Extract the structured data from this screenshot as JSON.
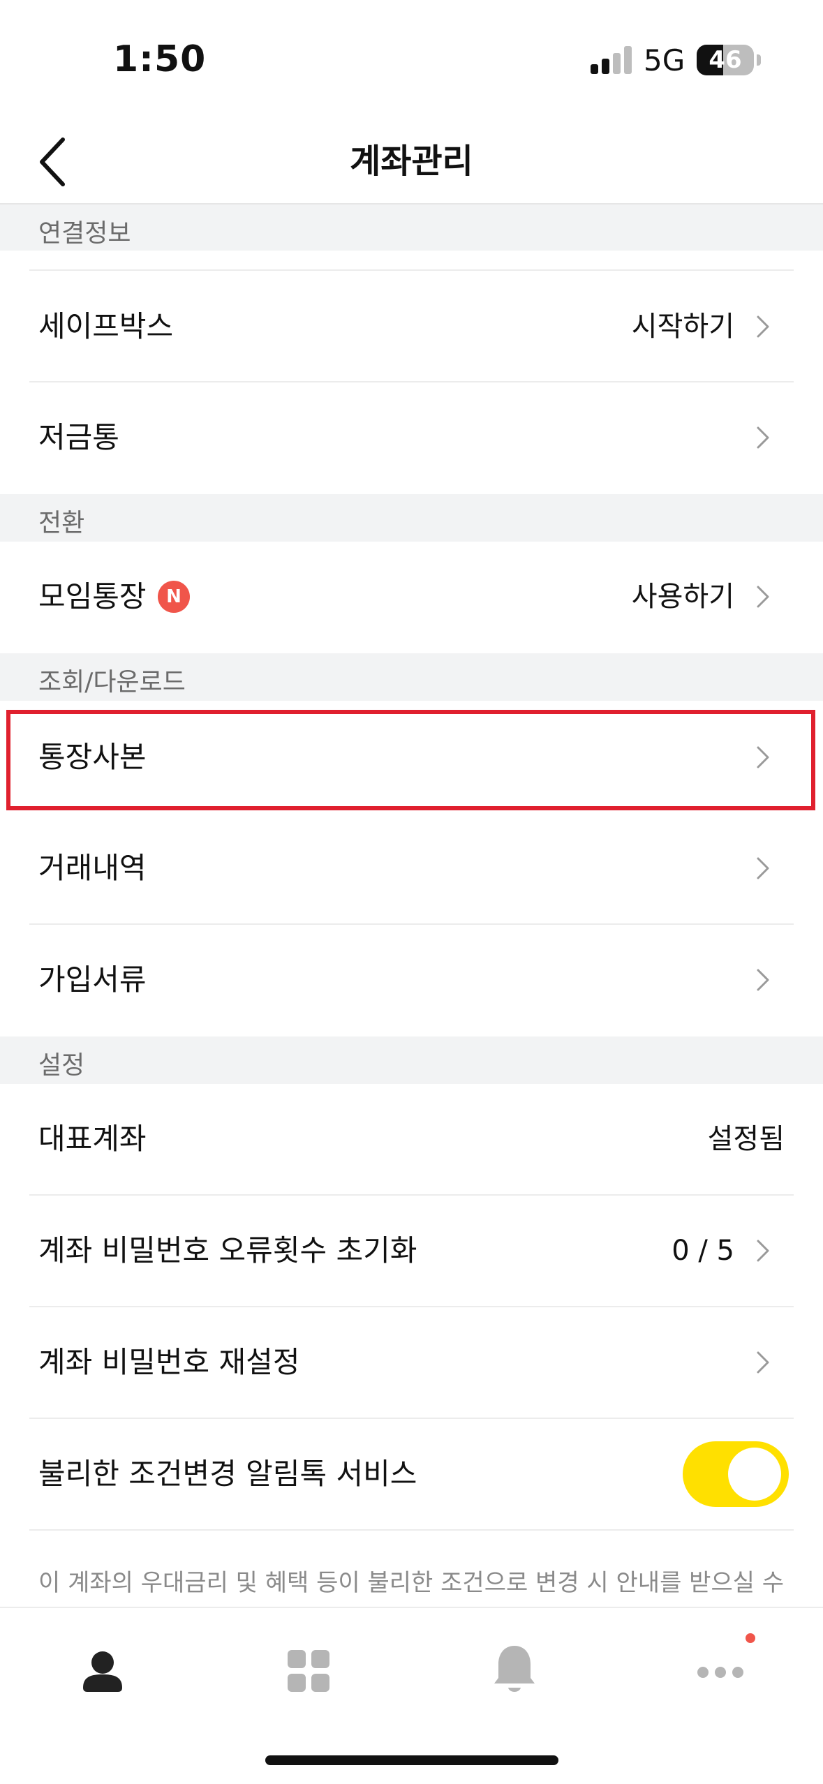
{
  "status_bar": {
    "time": "1:50",
    "network": "5G",
    "battery_level": "46",
    "battery_fraction": 0.46,
    "signal_bars_active": 2,
    "signal_bars_total": 4
  },
  "header": {
    "title": "계좌관리",
    "back_icon": "chevron-left-icon"
  },
  "sections": {
    "link_info": {
      "title": "연결정보"
    },
    "switch": {
      "title": "전환"
    },
    "lookup": {
      "title": "조회/다운로드"
    },
    "settings": {
      "title": "설정"
    }
  },
  "rows": {
    "safebox": {
      "label": "세이프박스",
      "value": "시작하기"
    },
    "piggybank": {
      "label": "저금통"
    },
    "group_account": {
      "label": "모임통장",
      "badge": "N",
      "value": "사용하기"
    },
    "passbook_copy": {
      "label": "통장사본"
    },
    "transactions": {
      "label": "거래내역"
    },
    "signup_docs": {
      "label": "가입서류"
    },
    "main_account": {
      "label": "대표계좌",
      "value": "설정됨"
    },
    "pw_error_reset": {
      "label": "계좌 비밀번호 오류횟수 초기화",
      "value": "0 / 5"
    },
    "pw_reset": {
      "label": "계좌 비밀번호 재설정"
    },
    "unfavorable_alert": {
      "label": "불리한 조건변경 알림톡 서비스",
      "enabled": true
    }
  },
  "note": "이 계좌의 우대금리 및 혜택 등이 불리한 조건으로 변경 시 안내를 받으실 수",
  "tabbar": {
    "items": [
      "person-icon",
      "grid-icon",
      "bell-icon",
      "more-dots-icon"
    ]
  },
  "colors": {
    "accent_yellow": "#ffe000",
    "badge_red": "#f0554a",
    "highlight_red": "#e0202e",
    "section_bg": "#f2f3f4"
  }
}
